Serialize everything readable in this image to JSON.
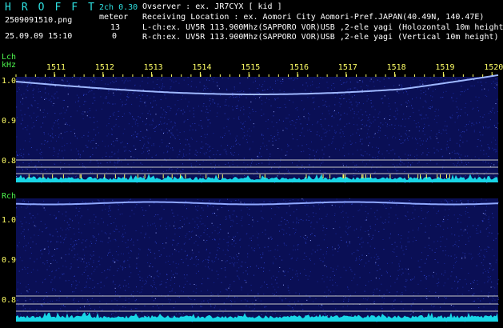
{
  "header": {
    "title": "HROFFT",
    "version": "2ch 0.30",
    "filename": "2509091510.png",
    "datetime": "25.09.09 15:10",
    "meteor_label": "meteor",
    "lch_count": "13",
    "rch_count": "0",
    "observer": "Ovserver           : ex. JR7CYX [ kid ]",
    "location": "Receiving Location : ex. Aomori City Aomori-Pref.JAPAN(40.49N, 140.47E)",
    "lch_info": "L-ch:ex. UV5R 113.900Mhz(SAPPORO VOR)USB ,2-ele yagi (Holozontal 10m height)",
    "rch_info": "R-ch:ex. UV5R 113.900Mhz(SAPPORO VOR)USB ,2-ele yagi (Vertical 10m height)"
  },
  "lch": {
    "label": "Lch",
    "unit": "kHz",
    "ticks": [
      "1.0",
      "0.9",
      "0.8"
    ]
  },
  "rch": {
    "label": "Rch",
    "ticks": [
      "1.0",
      "0.9",
      "0.8"
    ]
  },
  "time_ticks": [
    "1511",
    "1512",
    "1513",
    "1514",
    "1515",
    "1516",
    "1517",
    "1518",
    "1519",
    "1520"
  ],
  "colors": {
    "background": "#000000",
    "noise": "#1a2a9a",
    "trace": "#9fb8ff",
    "activity": "#19d6e6",
    "labels": "#ffff66",
    "channel": "#4cf24c"
  }
}
